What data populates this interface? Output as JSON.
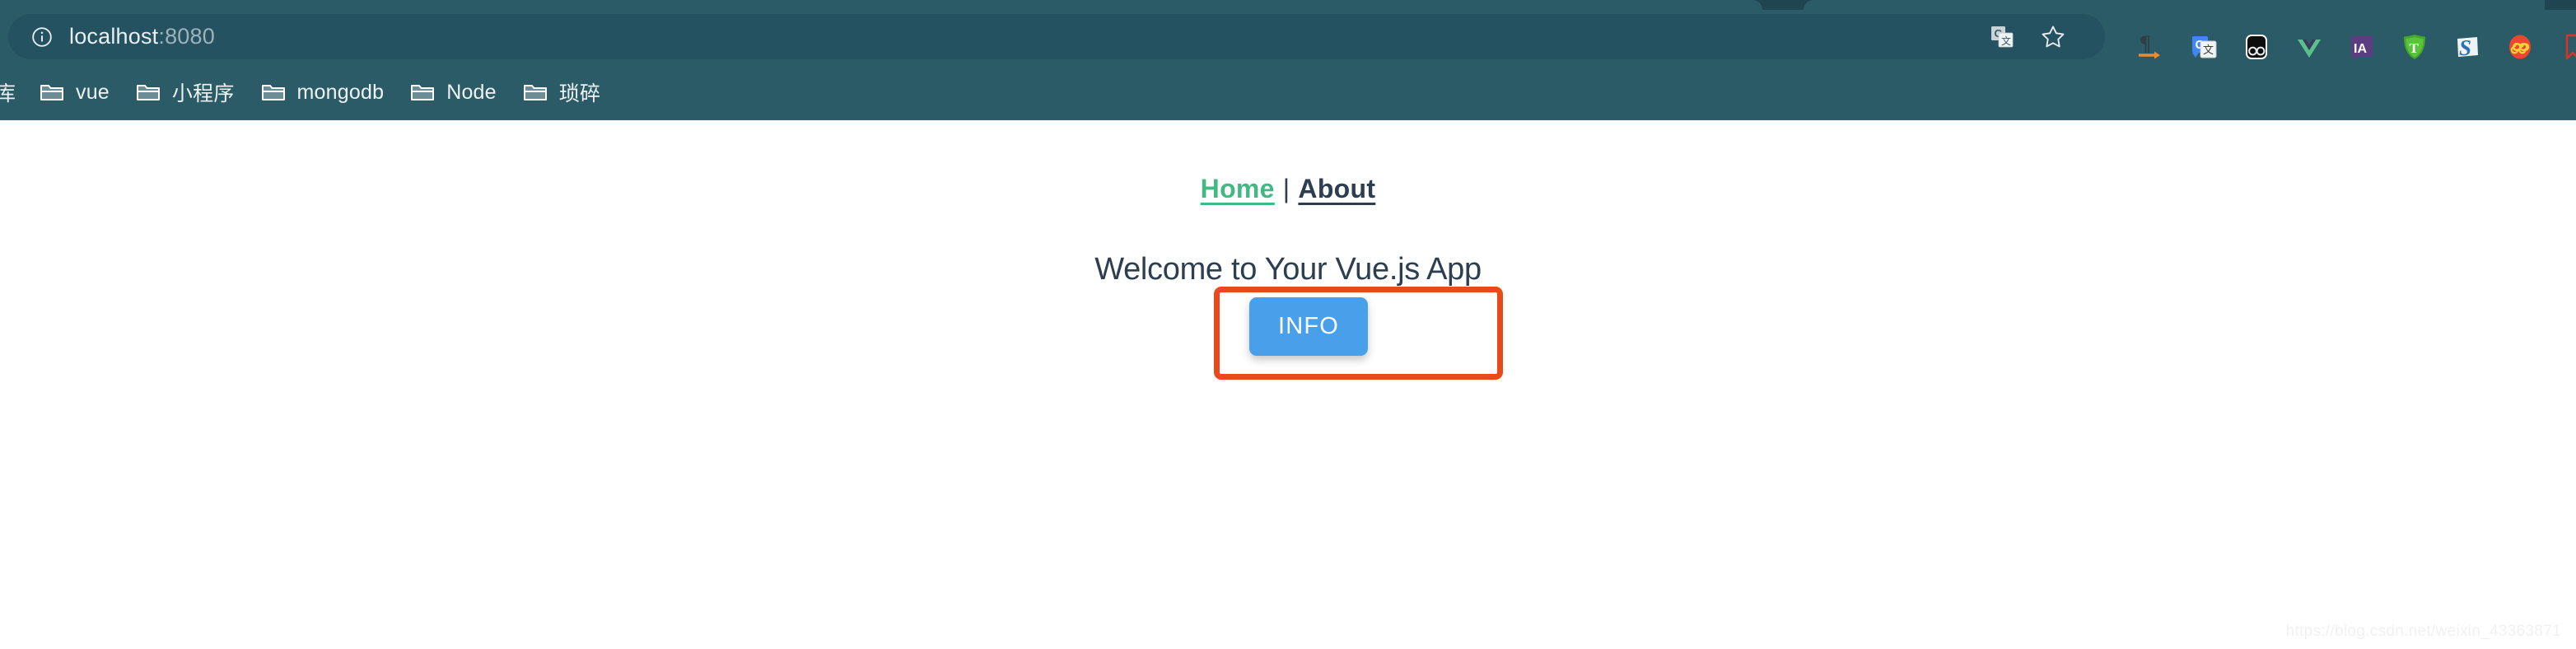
{
  "browser": {
    "omnibox": {
      "info_icon": "info-circle-icon",
      "url_host": "localhost",
      "url_port": ":8080",
      "translate_icon": "google-translate-icon",
      "bookmark_star_icon": "star-icon"
    },
    "extensions": [
      {
        "name": "pilcrow-arrow-icon",
        "label": ""
      },
      {
        "name": "google-translate-extension-icon",
        "label": "G"
      },
      {
        "name": "glasses-extension-icon",
        "label": ""
      },
      {
        "name": "vue-devtools-icon",
        "label": "V"
      },
      {
        "name": "ia-extension-icon",
        "label": "IA"
      },
      {
        "name": "shield-t-extension-icon",
        "label": "T"
      },
      {
        "name": "s-extension-icon",
        "label": "S"
      },
      {
        "name": "infinity-extension-icon",
        "label": "∞"
      },
      {
        "name": "bookmark-ribbon-icon",
        "label": ""
      }
    ],
    "bookmarks": {
      "clipped_label": "库",
      "items": [
        {
          "label": "vue",
          "icon": "folder-icon"
        },
        {
          "label": "小程序",
          "icon": "folder-icon"
        },
        {
          "label": "mongodb",
          "icon": "folder-icon"
        },
        {
          "label": "Node",
          "icon": "folder-icon"
        },
        {
          "label": "琐碎",
          "icon": "folder-icon"
        }
      ]
    }
  },
  "page": {
    "nav": {
      "home_label": "Home",
      "separator": "|",
      "about_label": "About"
    },
    "heading": "Welcome to Your Vue.js App",
    "info_button_label": "INFO",
    "watermark": "https://blog.csdn.net/weixin_43363871"
  },
  "colors": {
    "chrome_bg": "#2b5b66",
    "omnibox_bg": "#245260",
    "tab_strip_bg": "#1e4550",
    "vue_green": "#42b983",
    "vue_navy": "#2c3e50",
    "annotation_orange": "#e8491d",
    "button_blue": "#49a0ea"
  }
}
